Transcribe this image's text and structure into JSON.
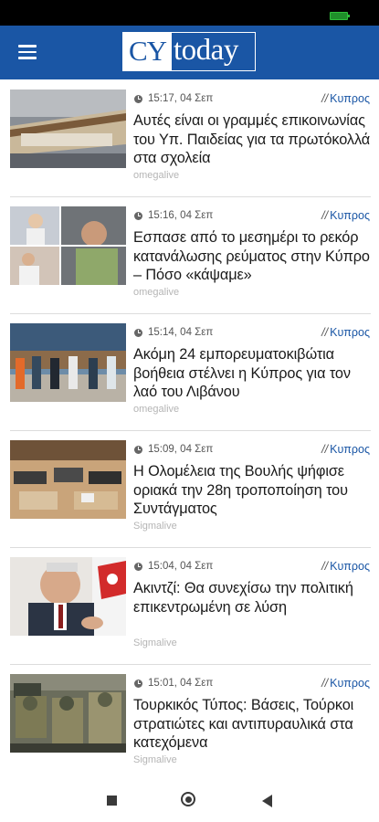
{
  "app": {
    "logo_part1": "CY",
    "logo_part2": "today",
    "brand_color": "#1a56a5"
  },
  "icons": {
    "menu": "hamburger-menu-icon",
    "time": "clock-icon",
    "nav_recents": "square-icon",
    "nav_home": "circle-icon",
    "nav_back": "triangle-back-icon"
  },
  "articles": [
    {
      "time": "15:17, 04 Σεπ",
      "category": "Κυπρος",
      "slashes": "//",
      "title": "Αυτές είναι οι γραμμές επικοινωνίας του Υπ. Παιδείας για τα πρωτόκολλά στα σχολεία",
      "source": "omegalive"
    },
    {
      "time": "15:16, 04 Σεπ",
      "category": "Κυπρος",
      "slashes": "//",
      "title": "Εσπασε από το μεσημέρι το ρεκόρ κατανάλωσης ρεύματος στην Κύπρο – Πόσο «κάψαμε»",
      "source": "omegalive"
    },
    {
      "time": "15:14, 04 Σεπ",
      "category": "Κυπρος",
      "slashes": "//",
      "title": "Ακόμη 24 εμπορευματοκιβώτια βοήθεια στέλνει η Κύπρος για τον λαό του Λιβάνου",
      "source": "omegalive"
    },
    {
      "time": "15:09, 04 Σεπ",
      "category": "Κυπρος",
      "slashes": "//",
      "title": "Η Ολομέλεια της Βουλής ψήφισε οριακά την 28η τροποποίηση του Συντάγματος",
      "source": "Sigmalive"
    },
    {
      "time": "15:04, 04 Σεπ",
      "category": "Κυπρος",
      "slashes": "//",
      "title": "Ακιντζί: Θα συνεχίσω την πολιτική επικεντρωμένη σε λύση",
      "source": "Sigmalive"
    },
    {
      "time": "15:01, 04 Σεπ",
      "category": "Κυπρος",
      "slashes": "//",
      "title": "Τουρκικός Τύπος: Βάσεις, Τούρκοι στρατιώτες και αντιπυραυλικά στα κατεχόμενα",
      "source": "Sigmalive"
    }
  ]
}
